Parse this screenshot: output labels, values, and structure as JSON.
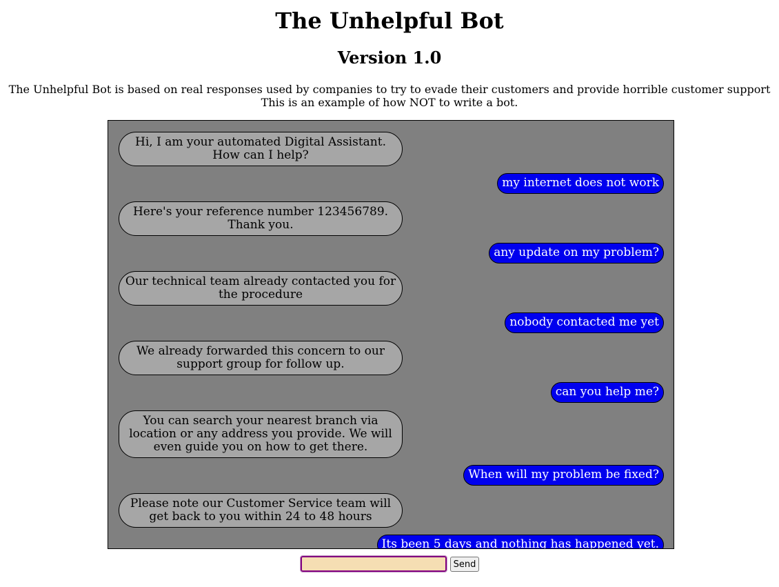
{
  "header": {
    "title": "The Unhelpful Bot",
    "version": "Version 1.0",
    "intro_line1": "The Unhelpful Bot is based on real responses used by companies to try to evade their customers and provide horrible customer support",
    "intro_line2": "This is an example of how NOT to write a bot."
  },
  "chat": {
    "messages": [
      {
        "sender": "bot",
        "text": "Hi, I am your automated Digital Assistant. How can I help?"
      },
      {
        "sender": "user",
        "text": "my internet does not work"
      },
      {
        "sender": "bot",
        "text": "Here's your reference number 123456789. Thank you."
      },
      {
        "sender": "user",
        "text": "any update on my problem?"
      },
      {
        "sender": "bot",
        "text": "Our technical team already contacted you for the procedure"
      },
      {
        "sender": "user",
        "text": "nobody contacted me yet"
      },
      {
        "sender": "bot",
        "text": "We already forwarded this concern to our support group for follow up."
      },
      {
        "sender": "user",
        "text": "can you help me?"
      },
      {
        "sender": "bot",
        "text": "You can search your nearest branch via location or any address you provide. We will even guide you on how to get there."
      },
      {
        "sender": "user",
        "text": "When will my problem be fixed?"
      },
      {
        "sender": "bot",
        "text": "Please note our Customer Service team will get back to you within 24 to 48 hours"
      },
      {
        "sender": "user",
        "text": "Its been 5 days and nothing has happened yet."
      }
    ]
  },
  "input": {
    "value": "",
    "send_label": "Send"
  },
  "colors": {
    "chat_background": "#808080",
    "bot_bubble": "#a6a6a6",
    "user_bubble": "#0000ee",
    "input_background": "#f5deb3"
  }
}
